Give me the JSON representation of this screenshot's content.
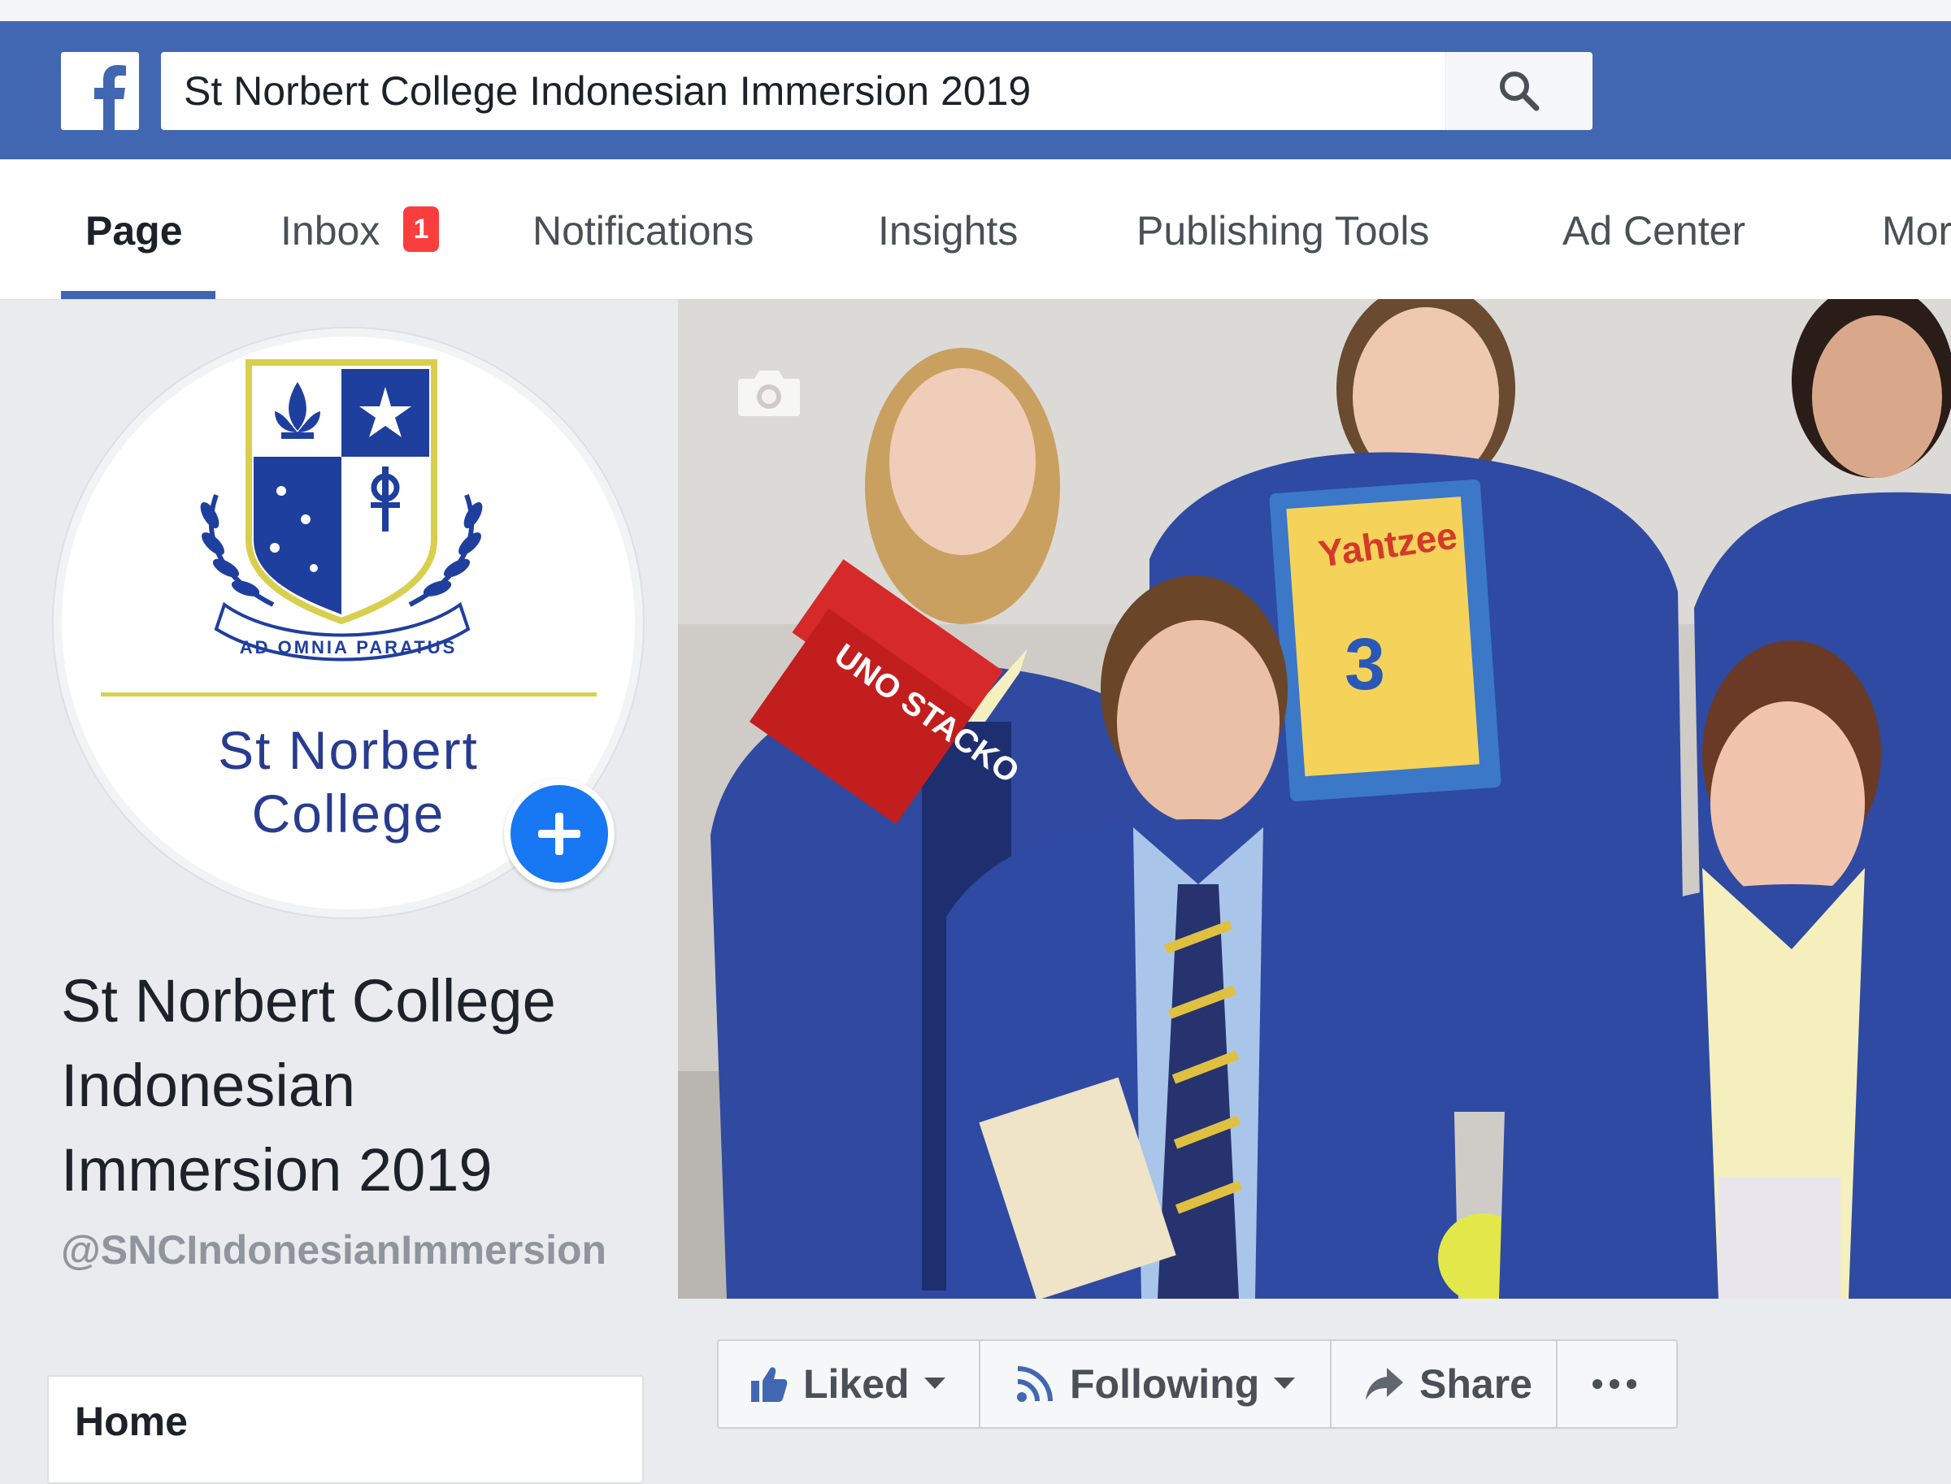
{
  "colors": {
    "facebook_blue": "#4267b2",
    "badge_red": "#fa3e3e",
    "add_button_blue": "#1877f2",
    "crest_blue": "#1f3f9e",
    "crest_gold": "#d9cf4e"
  },
  "header": {
    "logo_icon": "facebook-f-icon",
    "search": {
      "value": "St Norbert College Indonesian Immersion 2019",
      "button_icon": "search-icon"
    }
  },
  "tabs": [
    {
      "label": "Page",
      "active": true
    },
    {
      "label": "Inbox",
      "badge": "1"
    },
    {
      "label": "Notifications"
    },
    {
      "label": "Insights"
    },
    {
      "label": "Publishing Tools"
    },
    {
      "label": "Ad Center"
    },
    {
      "label": "More"
    }
  ],
  "profile": {
    "crest_motto": "AD OMNIA PARATUS",
    "logo_name_line1": "St Norbert",
    "logo_name_line2": "College",
    "add_icon": "plus-icon"
  },
  "page": {
    "title": "St Norbert College Indonesian Immersion 2019",
    "username": "@SNCIndonesianImmersion"
  },
  "sidebar": {
    "home_label": "Home"
  },
  "cover": {
    "camera_icon": "camera-icon",
    "box_labels": {
      "game1": "Yahtzee",
      "game1_sub": "3",
      "game2": "UNO STACKO"
    }
  },
  "actions": {
    "liked": "Liked",
    "following": "Following",
    "share": "Share",
    "more_icon": "more-dots-icon"
  }
}
